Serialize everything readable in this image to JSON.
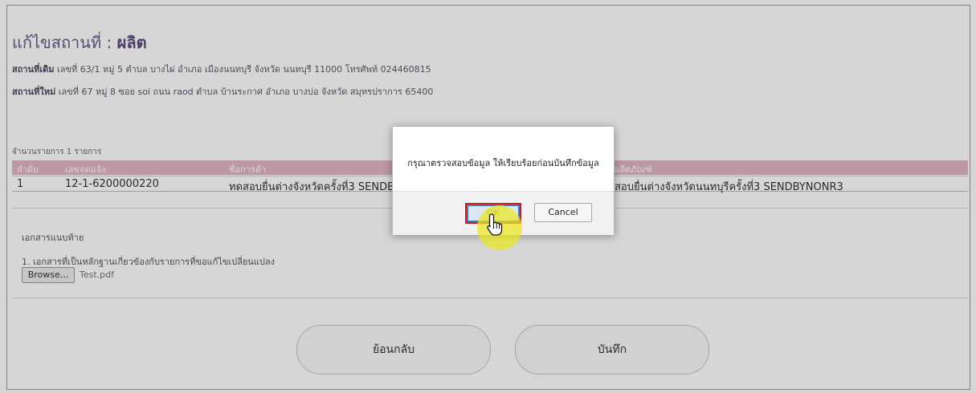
{
  "form": {
    "title_prefix": "แก้ไขสถานที่ : ",
    "title_value": "ผลิต",
    "old_address_label": "สถานที่เดิม",
    "old_address_value": " เลขที่ 63/1 หมู่ 5 ตำบล บางไผ่ อำเภอ เมืองนนทบุรี จังหวัด นนทบุรี 11000 โทรศัพท์ 024460815",
    "new_address_label": "สถานที่ใหม่",
    "new_address_value": " เลขที่ 67 หมู่ 8 ซอย soi ถนน raod ตำบล บ้านระกาศ อำเภอ บางบ่อ จังหวัด สมุทรปราการ 65400"
  },
  "table": {
    "count_text": "จำนวนรายการ 1 รายการ",
    "headers": [
      "ลำดับ",
      "เลขจดแจ้ง",
      "ชื่อการค้า",
      "ผลิตภัณฑ์"
    ],
    "rows": [
      [
        "1",
        "12-1-6200000220",
        "ทดสอบยื่นต่างจังหวัดครั้งที่3 SENDBY",
        "สอบยื่นต่างจังหวัดนนทบุรีครั้งที่3 SENDBYNONR3"
      ]
    ]
  },
  "attachments": {
    "section_title": "เอกสารแนบท้าย",
    "item_label": "1. เอกสารที่เป็นหลักฐานเกี่ยวข้องกับรายการที่ขอแก้ไขเปลี่ยนแปลง",
    "browse_label": "Browse...",
    "file_name": "Test.pdf"
  },
  "actions": {
    "back_label": "ย้อนกลับ",
    "save_label": "บันทึก"
  },
  "dialog": {
    "message": "กรุณาตรวจสอบข้อมูล ให้เรียบร้อยก่อนบันทึกข้อมูล",
    "ok_label": "OK",
    "cancel_label": "Cancel",
    "highlight_color": "#d21b1b",
    "cursor_halo_color": "#ece81e"
  }
}
